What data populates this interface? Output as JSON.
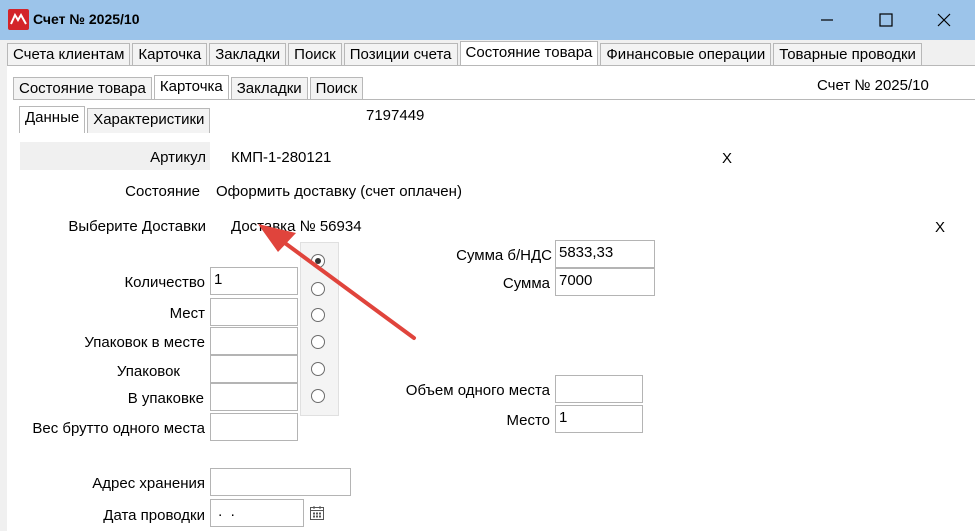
{
  "window": {
    "title": "Счет № 2025/10",
    "icon": "app-logo-icon"
  },
  "outer_tabs": [
    {
      "label": "Счета клиентам"
    },
    {
      "label": "Карточка"
    },
    {
      "label": "Закладки"
    },
    {
      "label": "Поиск"
    },
    {
      "label": "Позиции счета"
    },
    {
      "label": "Состояние товара"
    },
    {
      "label": "Финансовые операции"
    },
    {
      "label": "Товарные проводки"
    }
  ],
  "outer_active_tab": "Состояние товара",
  "inner_tabs": [
    {
      "label": "Состояние товара"
    },
    {
      "label": "Карточка"
    },
    {
      "label": "Закладки"
    },
    {
      "label": "Поиск"
    }
  ],
  "inner_active_tab": "Карточка",
  "sub_tabs": [
    {
      "label": "Данные"
    },
    {
      "label": "Характеристики"
    }
  ],
  "sub_active_tab": "Данные",
  "header_right": "Счет № 2025/10",
  "record_id": "7197449",
  "article": {
    "label": "Артикул",
    "value": "КМП-1-280121",
    "clear": "X"
  },
  "state": {
    "label": "Состояние",
    "value": "Оформить доставку (счет оплачен)"
  },
  "delivery": {
    "label": "Выберите Доставки",
    "value": "Доставка № 56934",
    "clear": "X"
  },
  "fields_left": [
    {
      "label": "Количество",
      "value": "1"
    },
    {
      "label": "Мест",
      "value": ""
    },
    {
      "label": "Упаковок в месте",
      "value": ""
    },
    {
      "label": "Упаковок",
      "value": ""
    },
    {
      "label": "В упаковке",
      "value": ""
    },
    {
      "label": "Вес брутто одного места",
      "value": ""
    }
  ],
  "radio_selected_index": 0,
  "sum_without_vat": {
    "label": "Сумма  б/НДС",
    "value": "5833,33"
  },
  "sum": {
    "label": "Сумма",
    "value": "7000"
  },
  "volume_one_place": {
    "label": "Объем одного места",
    "value": ""
  },
  "place": {
    "label": "Место",
    "value": "1"
  },
  "storage_address": {
    "label": "Адрес хранения",
    "value": ""
  },
  "posting_date": {
    "label": "Дата проводки",
    "value": " .  ."
  },
  "colors": {
    "titlebar": "#9cc4ea",
    "arrow": "#e0443c"
  }
}
